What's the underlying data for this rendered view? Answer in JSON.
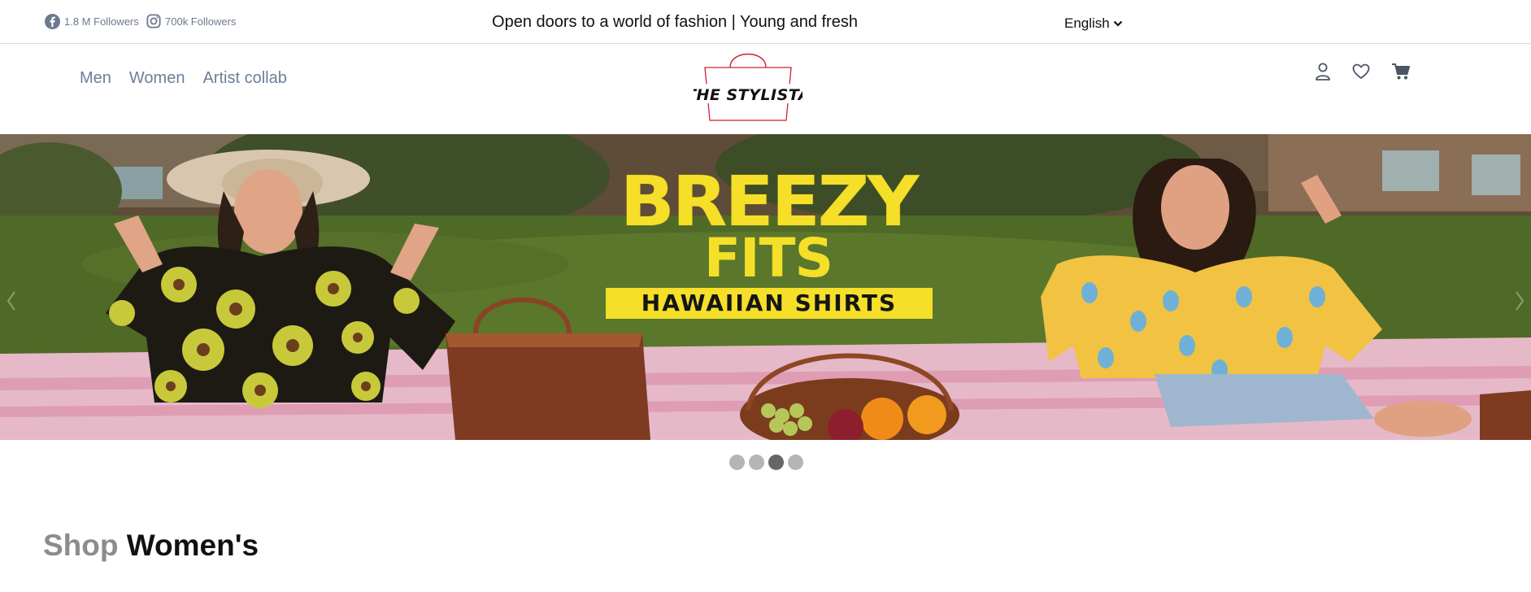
{
  "topbar": {
    "facebook": {
      "icon": "facebook-icon",
      "text": "1.8 M Followers"
    },
    "instagram": {
      "icon": "instagram-icon",
      "text": "700k Followers"
    },
    "announcement": "Open doors to a world of fashion | Young and fresh",
    "language": {
      "selected": "English",
      "icon": "chevron-down-icon"
    }
  },
  "nav": {
    "links": [
      {
        "label": "Men"
      },
      {
        "label": "Women"
      },
      {
        "label": "Artist collab"
      }
    ],
    "logo_text": "THE STYLISTA",
    "icons": [
      "user-icon",
      "heart-icon",
      "cart-icon"
    ]
  },
  "hero": {
    "line1": "BREEZY",
    "line2": "FITS",
    "tag": "HAWAIIAN SHIRTS",
    "slides": 4,
    "active_slide": 3
  },
  "section": {
    "title_muted": "Shop",
    "title_main": "Women's"
  },
  "colors": {
    "nav_link": "#6b7f99",
    "headline_yellow": "#f5df28",
    "logo_red": "#d0202e",
    "dot_active": "#666666",
    "dot_inactive": "#b5b5b5"
  }
}
